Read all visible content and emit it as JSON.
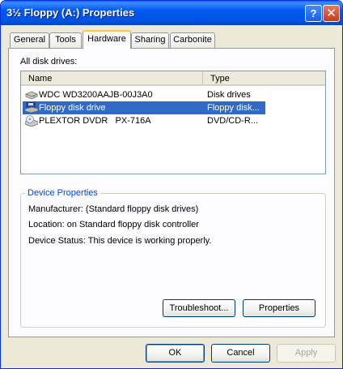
{
  "window": {
    "title": "3½ Floppy (A:) Properties",
    "help_glyph": "?",
    "close_glyph": "✕"
  },
  "tabs": [
    {
      "label": "General",
      "active": false
    },
    {
      "label": "Tools",
      "active": false
    },
    {
      "label": "Hardware",
      "active": true
    },
    {
      "label": "Sharing",
      "active": false
    },
    {
      "label": "Carbonite",
      "active": false
    }
  ],
  "drives": {
    "label": "All disk drives:",
    "columns": {
      "name": "Name",
      "type": "Type"
    },
    "rows": [
      {
        "name": "WDC WD3200AAJB-00J3A0",
        "type": "Disk drives",
        "icon": "hard-disk-icon",
        "selected": false
      },
      {
        "name": "Floppy disk drive",
        "type": "Floppy disk...",
        "icon": "floppy-drive-icon",
        "selected": true
      },
      {
        "name": "PLEXTOR DVDR   PX-716A",
        "type": "DVD/CD-R...",
        "icon": "optical-drive-icon",
        "selected": false
      }
    ]
  },
  "device_properties": {
    "title": "Device Properties",
    "manufacturer": "Manufacturer: (Standard floppy disk drives)",
    "location": "Location: on Standard floppy disk controller",
    "status": "Device Status: This device is working properly."
  },
  "buttons": {
    "troubleshoot": "Troubleshoot...",
    "properties": "Properties",
    "ok": "OK",
    "cancel": "Cancel",
    "apply": "Apply"
  },
  "colors": {
    "titlebar": "#0054e3",
    "selection": "#316ac5",
    "group_title": "#0046d5",
    "active_tab_accent": "#ffc83c"
  }
}
